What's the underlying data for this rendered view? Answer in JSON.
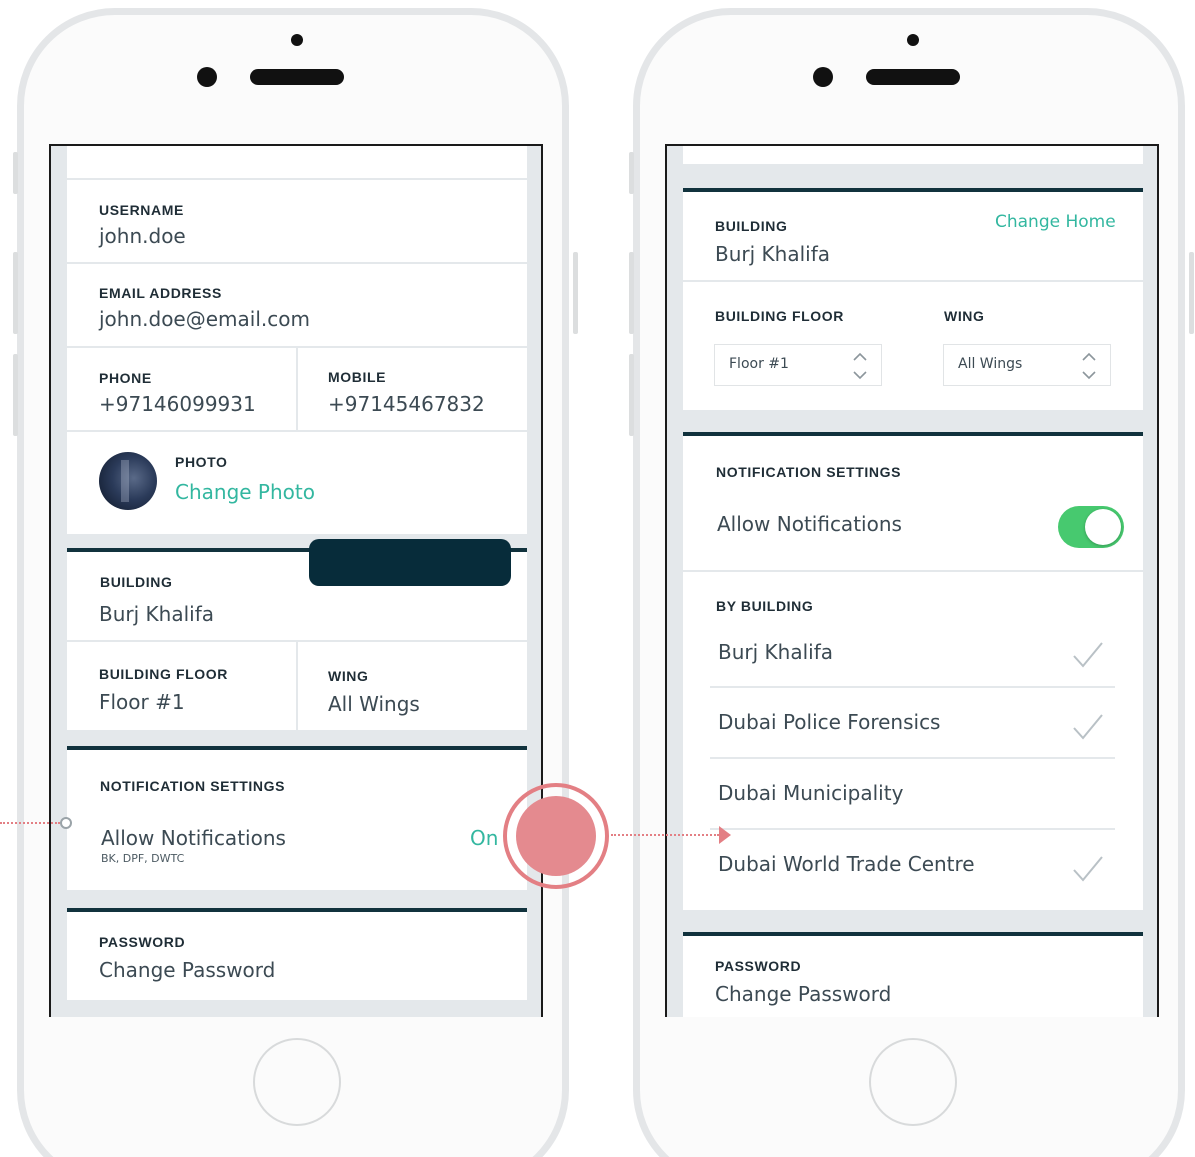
{
  "left_screen": {
    "username_label": "USERNAME",
    "username_value": "john.doe",
    "email_label": "EMAIL ADDRESS",
    "email_value": "john.doe@email.com",
    "phone_label": "PHONE",
    "phone_value": "+97146099931",
    "mobile_label": "MOBILE",
    "mobile_value": "+97145467832",
    "photo_label": "PHOTO",
    "photo_action": "Change Photo",
    "building_label": "BUILDING",
    "building_value": "Burj Khalifa",
    "floor_label": "BUILDING FLOOR",
    "floor_value": "Floor #1",
    "wing_label": "WING",
    "wing_value": "All Wings",
    "notif_label": "NOTIFICATION SETTINGS",
    "notif_title": "Allow Notifications",
    "notif_sub": "BK, DPF, DWTC",
    "notif_state": "On",
    "password_label": "PASSWORD",
    "password_action": "Change Password"
  },
  "right_screen": {
    "building_label": "BUILDING",
    "building_value": "Burj Khalifa",
    "change_home": "Change Home",
    "floor_label": "BUILDING FLOOR",
    "floor_select": "Floor #1",
    "wing_label": "WING",
    "wing_select": "All Wings",
    "notif_label": "NOTIFICATION SETTINGS",
    "notif_title": "Allow Notifications",
    "notif_toggle_on": true,
    "by_building_label": "BY BUILDING",
    "buildings": [
      {
        "name": "Burj Khalifa",
        "checked": true
      },
      {
        "name": "Dubai Police Forensics",
        "checked": true
      },
      {
        "name": "Dubai Municipality",
        "checked": false
      },
      {
        "name": "Dubai World Trade Centre",
        "checked": true
      }
    ],
    "password_label": "PASSWORD",
    "password_action": "Change Password"
  },
  "colors": {
    "accent": "#33b7a0",
    "toggle_on": "#47c96f",
    "section_bar": "#11323d",
    "highlight": "#e37f84"
  }
}
